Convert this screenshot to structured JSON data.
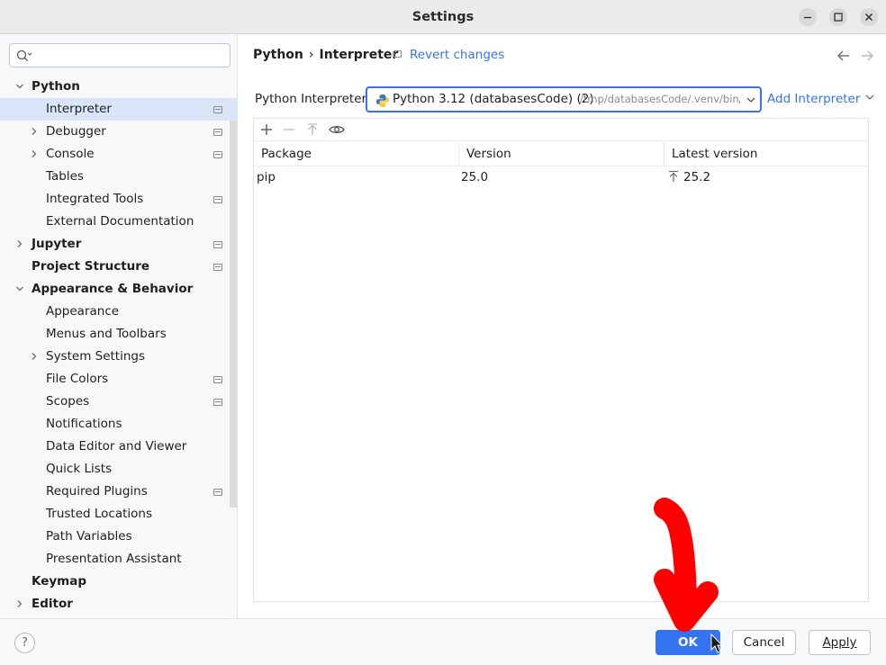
{
  "window": {
    "title": "Settings"
  },
  "sidebar": {
    "search_placeholder": "",
    "items": [
      {
        "label": "Python",
        "level": 0,
        "bold": true,
        "chevron": "down"
      },
      {
        "label": "Interpreter",
        "level": 1,
        "selected": true,
        "pin": true
      },
      {
        "label": "Debugger",
        "level": 1,
        "chevron": "right",
        "pin": true
      },
      {
        "label": "Console",
        "level": 1,
        "chevron": "right",
        "pin": true
      },
      {
        "label": "Tables",
        "level": 1
      },
      {
        "label": "Integrated Tools",
        "level": 1,
        "pin": true
      },
      {
        "label": "External Documentation",
        "level": 1
      },
      {
        "label": "Jupyter",
        "level": 0,
        "bold": true,
        "chevron": "right",
        "pin": true
      },
      {
        "label": "Project Structure",
        "level": 0,
        "bold": true,
        "pin": true
      },
      {
        "label": "Appearance & Behavior",
        "level": 0,
        "bold": true,
        "chevron": "down"
      },
      {
        "label": "Appearance",
        "level": 1
      },
      {
        "label": "Menus and Toolbars",
        "level": 1
      },
      {
        "label": "System Settings",
        "level": 1,
        "chevron": "right"
      },
      {
        "label": "File Colors",
        "level": 1,
        "pin": true
      },
      {
        "label": "Scopes",
        "level": 1,
        "pin": true
      },
      {
        "label": "Notifications",
        "level": 1
      },
      {
        "label": "Data Editor and Viewer",
        "level": 1
      },
      {
        "label": "Quick Lists",
        "level": 1
      },
      {
        "label": "Required Plugins",
        "level": 1,
        "pin": true
      },
      {
        "label": "Trusted Locations",
        "level": 1
      },
      {
        "label": "Path Variables",
        "level": 1
      },
      {
        "label": "Presentation Assistant",
        "level": 1
      },
      {
        "label": "Keymap",
        "level": 0,
        "bold": true
      },
      {
        "label": "Editor",
        "level": 0,
        "bold": true,
        "chevron": "right"
      }
    ]
  },
  "breadcrumb": {
    "parent": "Python",
    "separator": "›",
    "current": "Interpreter"
  },
  "revert_label": "Revert changes",
  "interpreter": {
    "label": "Python Interpreter:",
    "name": "Python 3.12 (databasesCode) (2)",
    "path": "/tmp/databasesCode/.venv/bin/p",
    "add_label": "Add Interpreter"
  },
  "packages": {
    "columns": [
      "Package",
      "Version",
      "Latest version"
    ],
    "rows": [
      {
        "package": "pip",
        "version": "25.0",
        "latest": "25.2"
      }
    ]
  },
  "footer": {
    "help": "?",
    "ok": "OK",
    "cancel": "Cancel",
    "apply": "Apply"
  },
  "colors": {
    "accent": "#3574f0",
    "selection": "#dbe5f9",
    "annotation_arrow": "#ff0000"
  }
}
